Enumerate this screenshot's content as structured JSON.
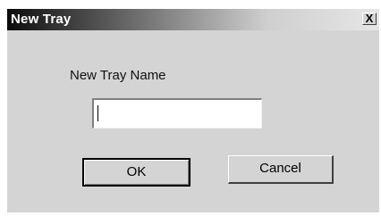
{
  "dialog": {
    "title": "New Tray",
    "close_symbol": "X",
    "close_icon": "close-icon"
  },
  "form": {
    "label": "New Tray Name",
    "name_value": ""
  },
  "buttons": {
    "ok_label": "OK",
    "cancel_label": "Cancel"
  }
}
